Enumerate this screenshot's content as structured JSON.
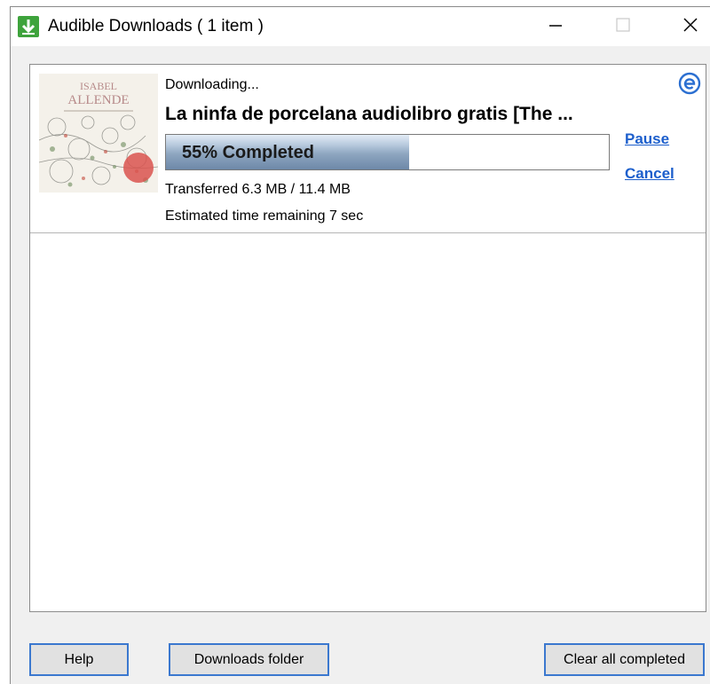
{
  "window": {
    "title": "Audible Downloads ( 1 item )",
    "icon": "download-arrow-icon",
    "controls": {
      "minimize": "minimize-icon",
      "maximize": "maximize-icon",
      "close": "close-icon"
    }
  },
  "download": {
    "status": "Downloading...",
    "title": "La ninfa de porcelana audiolibro gratis [The ...",
    "progress_percent": 55,
    "progress_label": "55% Completed",
    "transferred": "Transferred 6.3 MB / 11.4 MB",
    "eta": "Estimated time remaining 7 sec",
    "pause_label": "Pause",
    "cancel_label": "Cancel",
    "cover": {
      "author_line1": "ISABEL",
      "author_line2": "ALLENDE"
    },
    "browser_icon": "e-icon"
  },
  "footer": {
    "help_label": "Help",
    "folder_label": "Downloads folder",
    "clear_label": "Clear all completed"
  },
  "colors": {
    "link": "#1d5fcc",
    "progress_fill": "#8ea6c0",
    "button_border": "#3b78cf"
  }
}
